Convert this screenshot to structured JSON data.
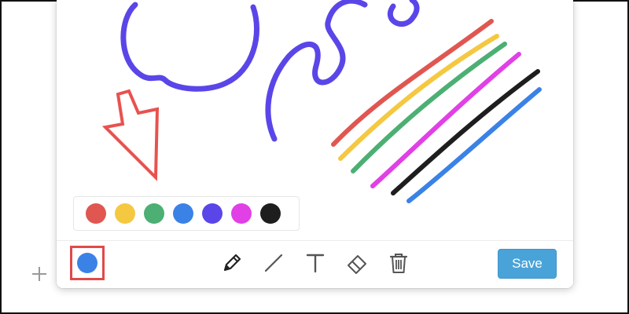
{
  "toolbar": {
    "save_label": "Save",
    "current_color": "#3b82e6",
    "tools": [
      "pencil-icon",
      "line-icon",
      "text-icon",
      "eraser-icon",
      "trash-icon"
    ]
  },
  "palette": {
    "colors": [
      {
        "name": "red",
        "hex": "#e05651"
      },
      {
        "name": "yellow",
        "hex": "#f5c842"
      },
      {
        "name": "green",
        "hex": "#4caf73"
      },
      {
        "name": "blue",
        "hex": "#3b82e6"
      },
      {
        "name": "purple",
        "hex": "#5a46e8"
      },
      {
        "name": "magenta",
        "hex": "#e040e6"
      },
      {
        "name": "black",
        "hex": "#1e1e1e"
      }
    ]
  },
  "colors": {
    "save_button": "#4aa3d8",
    "selection_outline": "#e04a4a",
    "arrow_annotation": "#e8524f"
  }
}
